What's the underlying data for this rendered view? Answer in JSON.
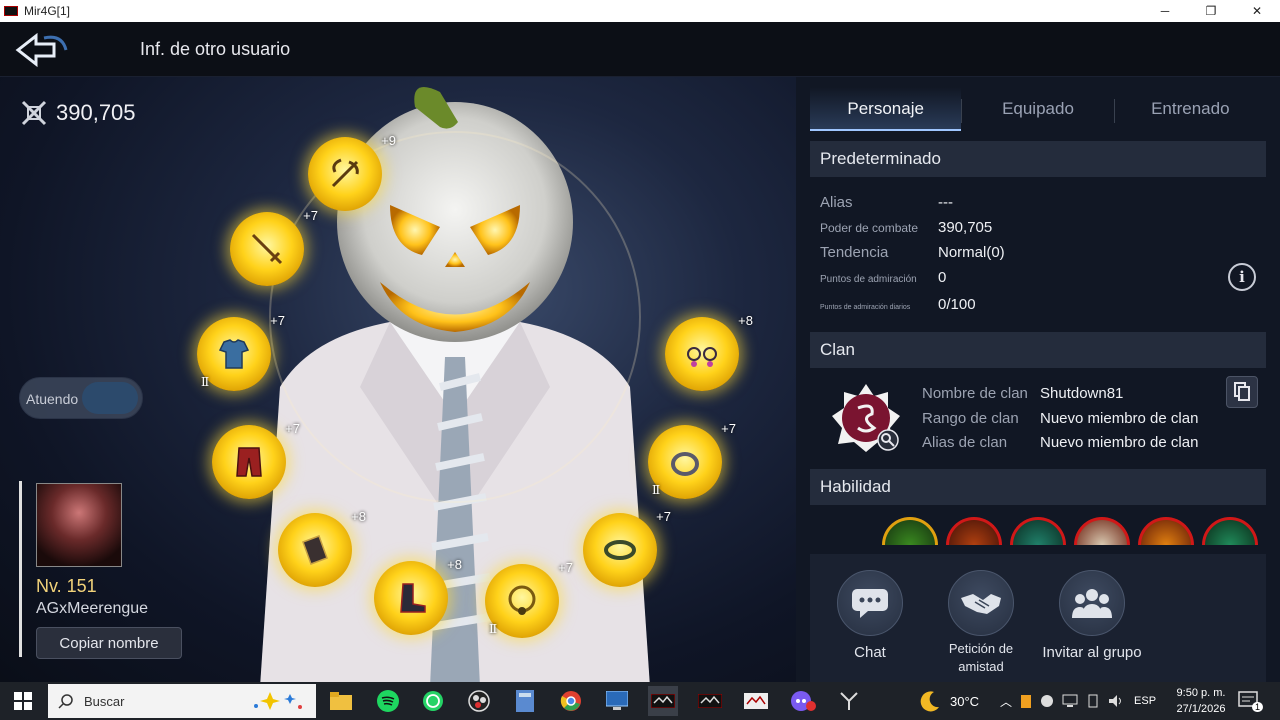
{
  "window": {
    "title": "Mir4G[1]",
    "minimize": "─",
    "restore": "❐",
    "close": "✕"
  },
  "header": {
    "title": "Inf. de otro usuario"
  },
  "scene": {
    "combat_power": "390,705",
    "outfit_toggle_label": "Atuendo",
    "profile": {
      "level": "Nv. 151",
      "name": "AGxMeerengue",
      "copy_name_label": "Copiar nombre"
    },
    "gear": [
      {
        "name": "weapon",
        "plus": "+9",
        "tier": ""
      },
      {
        "name": "dagger",
        "plus": "+7",
        "tier": ""
      },
      {
        "name": "armor",
        "plus": "+7",
        "tier": "Ⅱ"
      },
      {
        "name": "pants",
        "plus": "+7",
        "tier": ""
      },
      {
        "name": "gloves",
        "plus": "+8",
        "tier": ""
      },
      {
        "name": "boots",
        "plus": "+8",
        "tier": ""
      },
      {
        "name": "necklace",
        "plus": "+7",
        "tier": "Ⅱ"
      },
      {
        "name": "earrings",
        "plus": "+8",
        "tier": ""
      },
      {
        "name": "ring",
        "plus": "+7",
        "tier": "Ⅱ"
      },
      {
        "name": "bracelet",
        "plus": "+7",
        "tier": ""
      }
    ]
  },
  "panel": {
    "tabs": [
      "Personaje",
      "Equipado",
      "Entrenado"
    ],
    "active_tab": "Personaje",
    "predeterminado": {
      "heading": "Predeterminado",
      "rows": [
        {
          "label": "Alias",
          "value": "---"
        },
        {
          "label": "Poder de combate",
          "value": "390,705"
        },
        {
          "label": "Tendencia",
          "value": "Normal(0)"
        },
        {
          "label": "Puntos de admiración",
          "value": "0"
        },
        {
          "label": "Puntos de admiración diarios",
          "value": "0/100"
        }
      ],
      "info_icon": "i"
    },
    "clan": {
      "heading": "Clan",
      "rows": [
        {
          "label": "Nombre de clan",
          "value": "Shutdown81"
        },
        {
          "label": "Rango de clan",
          "value": "Nuevo miembro de clan"
        },
        {
          "label": "Alias de clan",
          "value": "Nuevo miembro de clan"
        }
      ]
    },
    "skills": {
      "heading": "Habilidad",
      "count": 6
    },
    "actions": [
      {
        "label": "Chat"
      },
      {
        "label": "Petición de amistad"
      },
      {
        "label": "Invitar al grupo"
      }
    ]
  },
  "taskbar": {
    "search_placeholder": "Buscar",
    "weather": "30°C",
    "language": "ESP",
    "time": "9:50 p. m.",
    "date": "27/1/2026",
    "notifications": "1"
  },
  "colors": {
    "accent": "#9fc6ff",
    "gold": "#ffd21a",
    "level": "#f1d27a"
  }
}
